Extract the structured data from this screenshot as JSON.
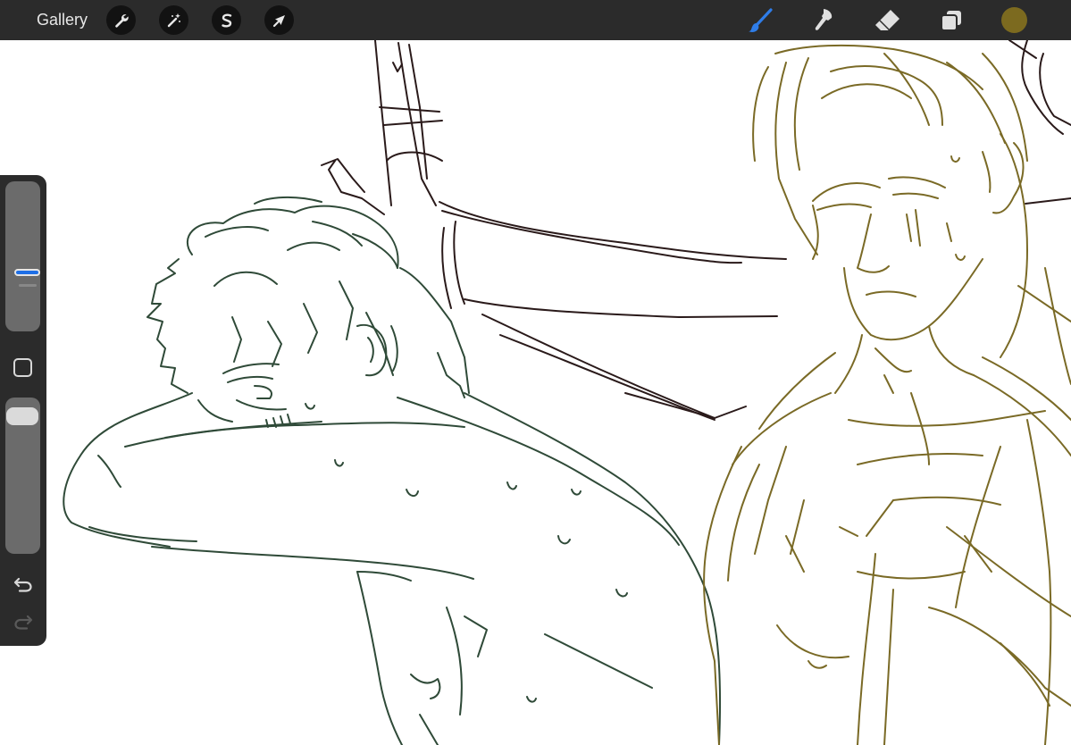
{
  "toolbar": {
    "gallery_label": "Gallery",
    "left_tools": [
      "wrench-icon",
      "magic-wand-icon",
      "selection-s-icon",
      "transform-arrow-icon"
    ],
    "right_tools": [
      "brush-icon",
      "smudge-icon",
      "eraser-icon",
      "layers-icon"
    ],
    "active_tool": "brush",
    "current_color": "#7c6a1f"
  },
  "sidebar": {
    "brush_size_level": 0.38,
    "brush_opacity_level": 0.06,
    "buttons": [
      "modify-square",
      "undo-icon",
      "redo-icon"
    ]
  },
  "canvas": {
    "stroke_colors": {
      "left_figure": "#2f4a38",
      "arm": "#2a1a1a",
      "right_figure": "#7a6a26"
    }
  },
  "colors": {
    "toolbar_bg": "#2b2b2b",
    "accent_blue": "#1e6fe6"
  }
}
